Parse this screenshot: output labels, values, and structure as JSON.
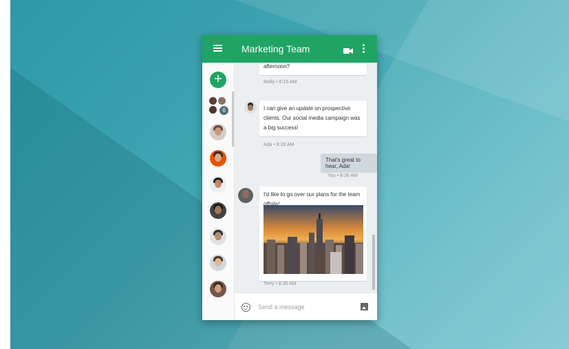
{
  "header": {
    "title": "Marketing Team"
  },
  "icons": {
    "menu": "menu-icon",
    "video": "video-call-icon",
    "more": "more-vert-icon",
    "add": "add-icon",
    "expand": "chevron-right-icon",
    "emoji": "emoji-icon",
    "image": "image-icon"
  },
  "sidebar": {
    "fab_label": "+",
    "group_badge": "6",
    "expand_label": "›"
  },
  "messages": [
    {
      "text": "afternoon?",
      "meta": "Molly • 8:15 AM"
    },
    {
      "text": "I can give an update on prospective clients. Our social media campaign was a big success!",
      "meta": "Ada • 8:26 AM"
    },
    {
      "text": "That's great to hear, Ada!",
      "meta": "You • 8:26 AM"
    },
    {
      "text": "I'd like to go over our plans for the team offsite!",
      "meta": "Terry • 8:30 AM"
    }
  ],
  "composer": {
    "placeholder": "Send a message"
  },
  "colors": {
    "accent": "#1fa463",
    "chat_bg": "#eceff1",
    "self_bubble": "#cfd8dc"
  }
}
